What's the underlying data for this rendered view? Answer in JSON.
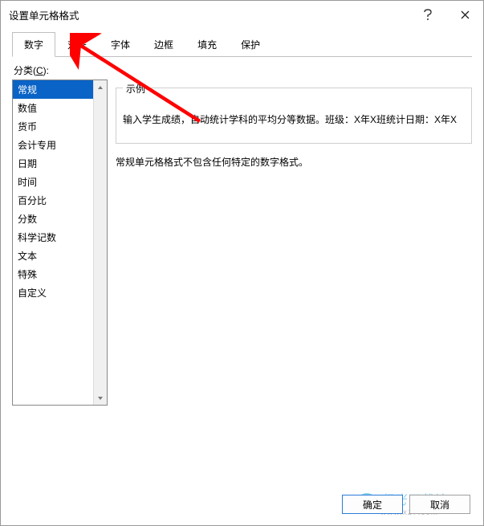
{
  "title": "设置单元格格式",
  "tabs": [
    {
      "label": "数字",
      "active": true
    },
    {
      "label": "对齐",
      "active": false
    },
    {
      "label": "字体",
      "active": false
    },
    {
      "label": "边框",
      "active": false
    },
    {
      "label": "填充",
      "active": false
    },
    {
      "label": "保护",
      "active": false
    }
  ],
  "category": {
    "label_prefix": "分类(",
    "label_key": "C",
    "label_suffix": "):",
    "items": [
      "常规",
      "数值",
      "货币",
      "会计专用",
      "日期",
      "时间",
      "百分比",
      "分数",
      "科学记数",
      "文本",
      "特殊",
      "自定义"
    ],
    "selected": 0
  },
  "example": {
    "legend": "示例",
    "text": "输入学生成绩，自动统计学科的平均分等数据。班级：X年X班统计日期：X年X"
  },
  "description": "常规单元格格式不包含任何特定的数字格式。",
  "buttons": {
    "ok": "确定",
    "cancel": "取消"
  },
  "watermark": {
    "text": "极光下载站",
    "sub": "www.xz7.com"
  }
}
